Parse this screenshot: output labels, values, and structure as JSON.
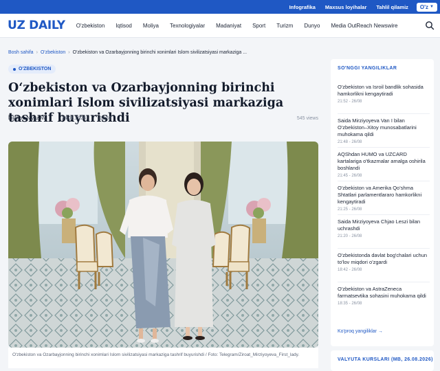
{
  "topbar": {
    "links": [
      "Infografika",
      "Maxsus loyihalar",
      "Tahlil qilamiz"
    ],
    "lang": "O'z"
  },
  "nav": {
    "logo": "UZ DAILY",
    "items": [
      "O'zbekiston",
      "Iqtisod",
      "Moliya",
      "Texnologiyalar",
      "Madaniyat",
      "Sport",
      "Turizm",
      "Dunyo",
      "Media OutReach Newswire"
    ]
  },
  "breadcrumb": {
    "home": "Bosh sahifa",
    "section": "O'zbekiston",
    "current": "O'zbekiston va Ozarbayjonning birinchi xonimlari Islom sivilizatsiyasi markaziga ..."
  },
  "article": {
    "category": "O'ZBEKISTON",
    "title": "O‘zbekiston va Ozarbayjonning birinchi xonimlari Islom sivilizatsiyasi markaziga tashrif buyurishdi",
    "author": "Dilafro'z Niyazova",
    "date": "24.08.2026",
    "time": "12:53",
    "views": "545 views",
    "caption": "O'zbekiston va Ozarbayjonning birinchi xonimlari Islom sivilizatsiyasi markaziga tashrif buyurishdi / Foto: Telegram/Ziroat_Mirziyoyeva_First_lady."
  },
  "sidebar": {
    "heading": "SO'NGGI YANGILIKLAR",
    "news": [
      {
        "title": "O'zbekiston va Isroil bandlik sohasida hamkorlikni kengaytiradi",
        "date": "21:52 - 26/08"
      },
      {
        "title": "Saida Mirziyoyeva Van I bilan O'zbekiston–Xitoy munosabatlarini muhokama qildi",
        "date": "21:48 - 26/08"
      },
      {
        "title": "AQShdan HUMO va UZCARD kartalariga o'tkazmalar amalga oshirila boshlandi",
        "date": "21:45 - 26/08"
      },
      {
        "title": "O'zbekiston va Amerika Qo'shma Shtatlari parlamentlararo hamkorlikni kengaytiradi",
        "date": "21:25 - 26/08"
      },
      {
        "title": "Saida Mirziyoyeva Chjao Leszi bilan uchrashdi",
        "date": "21:20 - 26/08"
      },
      {
        "title": "O'zbekistonda davlat bog'chalari uchun to'lov miqdori o'zgardi",
        "date": "18:42 - 26/08"
      },
      {
        "title": "O'zbekiston va AstraZeneca farmatsevtika sohasini muhokama qildi",
        "date": "18:35 - 26/08"
      }
    ],
    "more": "Ko'proq yangiliklar →",
    "currency_heading": "VALYUTA KURSLARI (MB, 26.08.2026)"
  },
  "colors": {
    "brand": "#1f58c4",
    "badge_bg": "#e4ecfb"
  }
}
